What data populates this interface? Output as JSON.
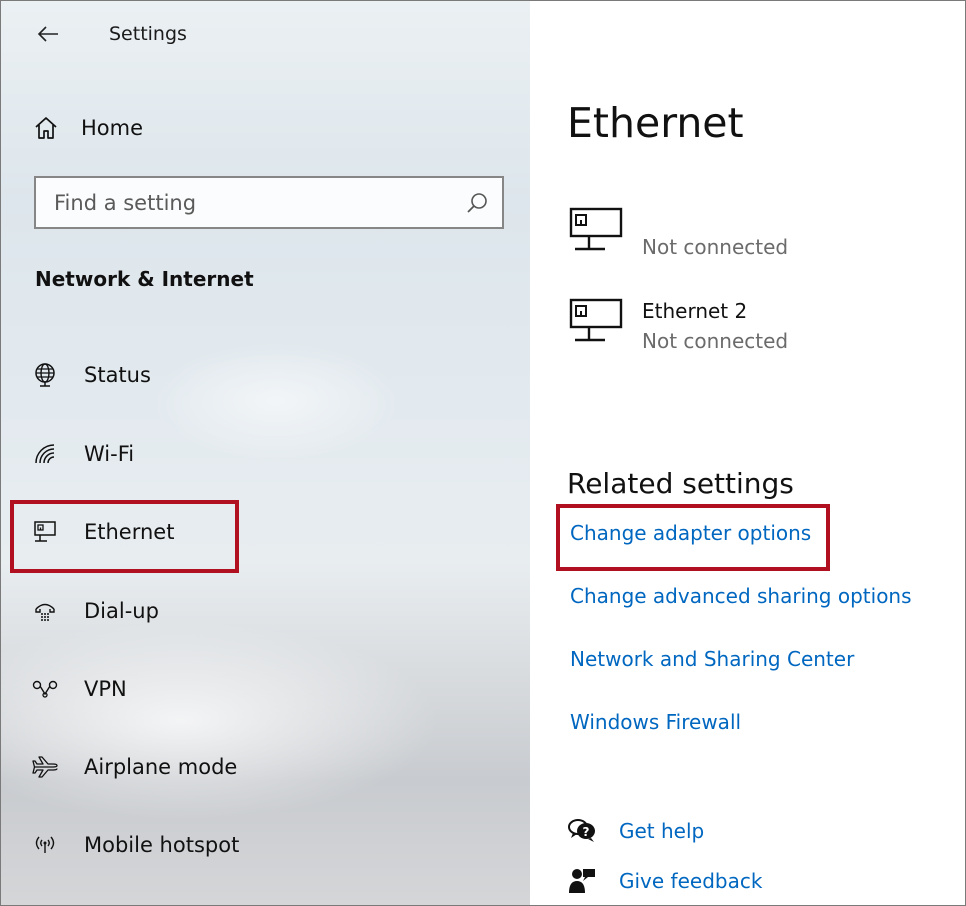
{
  "app": {
    "title": "Settings"
  },
  "sidebar": {
    "home_label": "Home",
    "search": {
      "placeholder": "Find a setting",
      "value": ""
    },
    "section_title": "Network & Internet",
    "items": [
      {
        "id": "status",
        "label": "Status",
        "icon": "globe-icon"
      },
      {
        "id": "wifi",
        "label": "Wi-Fi",
        "icon": "wifi-icon"
      },
      {
        "id": "ethernet",
        "label": "Ethernet",
        "icon": "ethernet-icon",
        "selected": true
      },
      {
        "id": "dialup",
        "label": "Dial-up",
        "icon": "dialup-icon"
      },
      {
        "id": "vpn",
        "label": "VPN",
        "icon": "vpn-icon"
      },
      {
        "id": "airplane",
        "label": "Airplane mode",
        "icon": "airplane-icon"
      },
      {
        "id": "hotspot",
        "label": "Mobile hotspot",
        "icon": "hotspot-icon"
      }
    ]
  },
  "main": {
    "title": "Ethernet",
    "adapters": [
      {
        "name": "",
        "status": "Not connected"
      },
      {
        "name": "Ethernet 2",
        "status": "Not connected"
      }
    ],
    "related_title": "Related settings",
    "related_links": [
      "Change adapter options",
      "Change advanced sharing options",
      "Network and Sharing Center",
      "Windows Firewall"
    ],
    "help": {
      "get_help": "Get help",
      "give_feedback": "Give feedback"
    }
  },
  "colors": {
    "accent": "#0067c0",
    "highlight_border": "#b01020"
  }
}
